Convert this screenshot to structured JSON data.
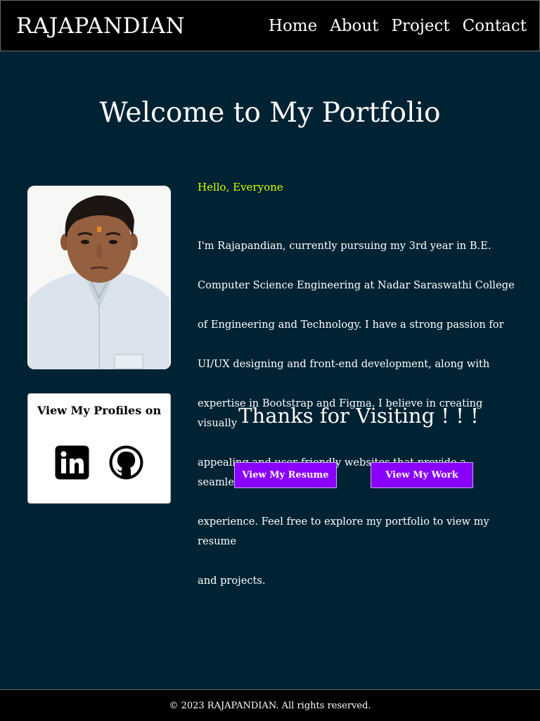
{
  "header": {
    "brand": "RAJAPANDIAN",
    "nav": [
      "Home",
      "About",
      "Project",
      "Contact"
    ]
  },
  "hero": {
    "title": "Welcome to My Portfolio"
  },
  "about": {
    "greeting": "Hello, Everyone",
    "bio_lines": [
      "I'm Rajapandian, currently pursuing my 3rd year in B.E.",
      "Computer Science Engineering at Nadar Saraswathi College",
      " of Engineering and Technology. I have a strong passion for",
      " UI/UX designing and front-end development, along with",
      "expertise in Bootstrap and Figma. I believe in creating visually",
      " appealing and user-friendly websites that provide a seamless",
      "experience. Feel free to explore my portfolio to view my resume",
      "and projects."
    ]
  },
  "profiles": {
    "title": "View My Profiles on",
    "icons": [
      "linkedin-icon",
      "github-icon"
    ]
  },
  "thanks": "Thanks for Visiting ! ! !",
  "buttons": {
    "resume": "View My Resume",
    "work": "View My Work"
  },
  "footer": {
    "text": "© 2023 RAJAPANDIAN. All rights reserved."
  },
  "colors": {
    "background": "#002333",
    "navbar": "#000000",
    "greeting": "#d4ff00",
    "button": "#8a00ff"
  }
}
